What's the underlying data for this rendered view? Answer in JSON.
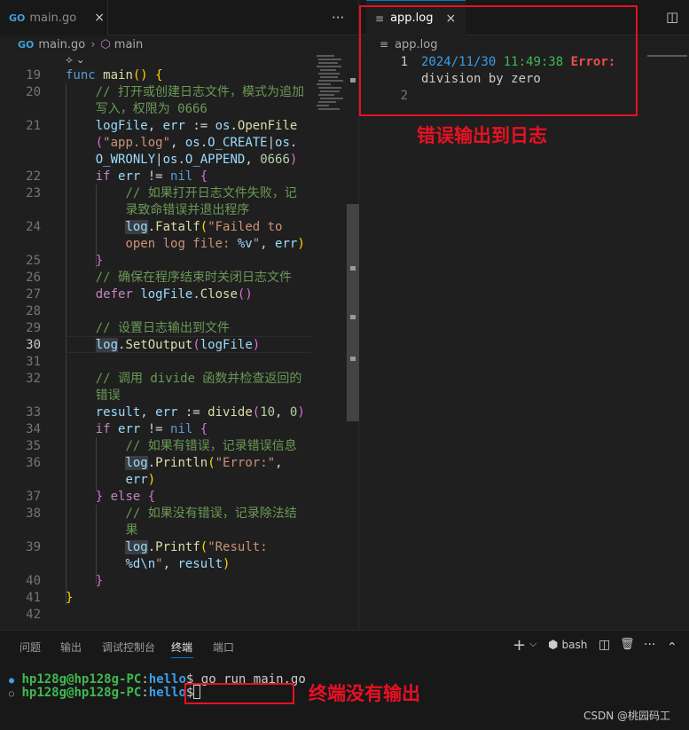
{
  "left_tab": {
    "icon": "GO",
    "label": "main.go",
    "close": "×"
  },
  "right_tab": {
    "label": "app.log",
    "close": "×"
  },
  "toolbar": {
    "more": "···",
    "split": "◫"
  },
  "left_breadcrumb": {
    "icon": "GO",
    "file": "main.go",
    "sep": "›",
    "symbol": "main"
  },
  "right_breadcrumb": {
    "file": "app.log"
  },
  "sticky_hint": "⟡ ⌄",
  "log_lines": {
    "n1": "1",
    "n2": "2",
    "date": "2024/11/30",
    "time": "11:49:38",
    "label": "Error:",
    "rest": "division by zero"
  },
  "annotations": {
    "log_output": "错误输出到日志",
    "terminal_no_output": "终端没有输出"
  },
  "panel": {
    "tabs": [
      "问题",
      "输出",
      "调试控制台",
      "终端",
      "端口"
    ],
    "shell": "bash",
    "tool_add": "+",
    "tool_chevron": "⌵",
    "tool_split": "◫",
    "tool_trash": "🗑",
    "tool_more": "···",
    "tool_up": "⌃"
  },
  "terminal": {
    "line1_prompt_user": "hp128g@hp128g-PC",
    "line1_prompt_path": "hello",
    "line1_cmd": "go run main.go",
    "line2_prompt_user": "hp128g@hp128g-PC",
    "line2_prompt_path": "hello"
  },
  "watermark": "CSDN @桃园码工",
  "colors": {
    "accent": "#0078d4",
    "annotation_red": "#e81123"
  }
}
